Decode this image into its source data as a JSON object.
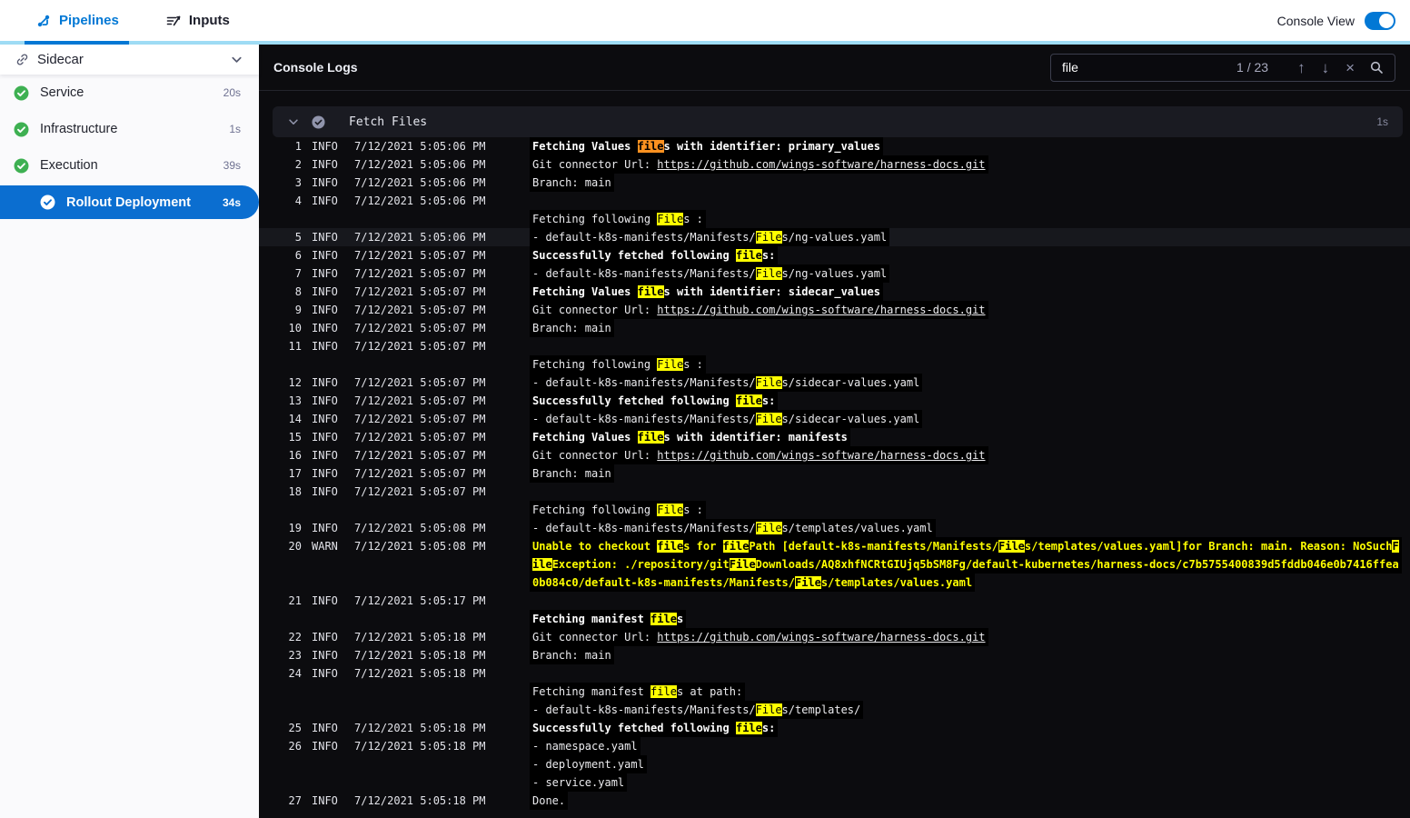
{
  "top_nav": {
    "tabs": [
      {
        "label": "Pipelines"
      },
      {
        "label": "Inputs"
      }
    ],
    "console_view_label": "Console View",
    "toggle_on": true
  },
  "sidebar": {
    "title": "Sidecar",
    "items": [
      {
        "label": "Service",
        "duration": "20s",
        "status": "success"
      },
      {
        "label": "Infrastructure",
        "duration": "1s",
        "status": "success"
      },
      {
        "label": "Execution",
        "duration": "39s",
        "status": "success"
      },
      {
        "label": "Rollout Deployment",
        "duration": "34s",
        "status": "success",
        "selected": true
      }
    ]
  },
  "console": {
    "title": "Console Logs",
    "search": {
      "value": "file",
      "counter": "1 / 23"
    },
    "section": {
      "title": "Fetch Files",
      "duration": "1s"
    }
  },
  "colors": {
    "primary_blue": "#0278d5",
    "selected_pill_blue": "#0b6ed0",
    "success_green": "#3eb052",
    "match_highlight": "#ffff00",
    "current_match_highlight": "#fb9120",
    "warn_text": "#ffff00",
    "tab_underline_light": "#9edcf5"
  },
  "log_rows": [
    {
      "n": "1",
      "lvl": "INFO",
      "t": "7/12/2021 5:05:06 PM",
      "seg": [
        [
          "Fetching Values ",
          "b"
        ],
        [
          "file",
          "ho"
        ],
        [
          "s with identifier: primary_values",
          "b"
        ]
      ]
    },
    {
      "n": "2",
      "lvl": "INFO",
      "t": "7/12/2021 5:05:06 PM",
      "seg": [
        [
          "Git connector Url: ",
          "n"
        ],
        [
          "https://github.com/wings-software/harness-docs.git",
          "l"
        ]
      ]
    },
    {
      "n": "3",
      "lvl": "INFO",
      "t": "7/12/2021 5:05:06 PM",
      "seg": [
        [
          "Branch: main",
          "n"
        ]
      ]
    },
    {
      "n": "4",
      "lvl": "INFO",
      "t": "7/12/2021 5:05:06 PM",
      "seg": []
    },
    {
      "seg": [
        [
          "Fetching following ",
          "n"
        ],
        [
          "File",
          "hy"
        ],
        [
          "s :",
          "n"
        ]
      ]
    },
    {
      "n": "5",
      "lvl": "INFO",
      "t": "7/12/2021 5:05:06 PM",
      "active": true,
      "seg": [
        [
          "- default-k8s-manifests/Manifests/",
          "n"
        ],
        [
          "File",
          "hy"
        ],
        [
          "s/ng-values.yaml",
          "n"
        ]
      ]
    },
    {
      "n": "6",
      "lvl": "INFO",
      "t": "7/12/2021 5:05:07 PM",
      "seg": [
        [
          "Successfully fetched following ",
          "b"
        ],
        [
          "file",
          "hyb"
        ],
        [
          "s:",
          "b"
        ]
      ]
    },
    {
      "n": "7",
      "lvl": "INFO",
      "t": "7/12/2021 5:05:07 PM",
      "seg": [
        [
          "- default-k8s-manifests/Manifests/",
          "n"
        ],
        [
          "File",
          "hy"
        ],
        [
          "s/ng-values.yaml",
          "n"
        ]
      ]
    },
    {
      "n": "8",
      "lvl": "INFO",
      "t": "7/12/2021 5:05:07 PM",
      "seg": [
        [
          "Fetching Values ",
          "b"
        ],
        [
          "file",
          "hyb"
        ],
        [
          "s with identifier: sidecar_values",
          "b"
        ]
      ]
    },
    {
      "n": "9",
      "lvl": "INFO",
      "t": "7/12/2021 5:05:07 PM",
      "seg": [
        [
          "Git connector Url: ",
          "n"
        ],
        [
          "https://github.com/wings-software/harness-docs.git",
          "l"
        ]
      ]
    },
    {
      "n": "10",
      "lvl": "INFO",
      "t": "7/12/2021 5:05:07 PM",
      "seg": [
        [
          "Branch: main",
          "n"
        ]
      ]
    },
    {
      "n": "11",
      "lvl": "INFO",
      "t": "7/12/2021 5:05:07 PM",
      "seg": []
    },
    {
      "seg": [
        [
          "Fetching following ",
          "n"
        ],
        [
          "File",
          "hy"
        ],
        [
          "s :",
          "n"
        ]
      ]
    },
    {
      "n": "12",
      "lvl": "INFO",
      "t": "7/12/2021 5:05:07 PM",
      "seg": [
        [
          "- default-k8s-manifests/Manifests/",
          "n"
        ],
        [
          "File",
          "hy"
        ],
        [
          "s/sidecar-values.yaml",
          "n"
        ]
      ]
    },
    {
      "n": "13",
      "lvl": "INFO",
      "t": "7/12/2021 5:05:07 PM",
      "seg": [
        [
          "Successfully fetched following ",
          "b"
        ],
        [
          "file",
          "hyb"
        ],
        [
          "s:",
          "b"
        ]
      ]
    },
    {
      "n": "14",
      "lvl": "INFO",
      "t": "7/12/2021 5:05:07 PM",
      "seg": [
        [
          "- default-k8s-manifests/Manifests/",
          "n"
        ],
        [
          "File",
          "hy"
        ],
        [
          "s/sidecar-values.yaml",
          "n"
        ]
      ]
    },
    {
      "n": "15",
      "lvl": "INFO",
      "t": "7/12/2021 5:05:07 PM",
      "seg": [
        [
          "Fetching Values ",
          "b"
        ],
        [
          "file",
          "hyb"
        ],
        [
          "s with identifier: manifests",
          "b"
        ]
      ]
    },
    {
      "n": "16",
      "lvl": "INFO",
      "t": "7/12/2021 5:05:07 PM",
      "seg": [
        [
          "Git connector Url: ",
          "n"
        ],
        [
          "https://github.com/wings-software/harness-docs.git",
          "l"
        ]
      ]
    },
    {
      "n": "17",
      "lvl": "INFO",
      "t": "7/12/2021 5:05:07 PM",
      "seg": [
        [
          "Branch: main",
          "n"
        ]
      ]
    },
    {
      "n": "18",
      "lvl": "INFO",
      "t": "7/12/2021 5:05:07 PM",
      "seg": []
    },
    {
      "seg": [
        [
          "Fetching following ",
          "n"
        ],
        [
          "File",
          "hy"
        ],
        [
          "s :",
          "n"
        ]
      ]
    },
    {
      "n": "19",
      "lvl": "INFO",
      "t": "7/12/2021 5:05:08 PM",
      "seg": [
        [
          "- default-k8s-manifests/Manifests/",
          "n"
        ],
        [
          "File",
          "hy"
        ],
        [
          "s/templates/values.yaml",
          "n"
        ]
      ]
    },
    {
      "n": "20",
      "lvl": "WARN",
      "t": "7/12/2021 5:05:08 PM",
      "seg": [
        [
          "Unable to checkout ",
          "w"
        ],
        [
          "file",
          "hyb"
        ],
        [
          "s for ",
          "w"
        ],
        [
          "file",
          "hyb"
        ],
        [
          "Path [default-k8s-manifests/Manifests/",
          "w"
        ],
        [
          "File",
          "hyb"
        ],
        [
          "s/templates/values.yaml]for Branch: main. Reason: NoSuch",
          "w"
        ],
        [
          "F",
          "hyb"
        ]
      ]
    },
    {
      "seg": [
        [
          "ile",
          "hyb"
        ],
        [
          "Exception: ./repository/git",
          "w"
        ],
        [
          "File",
          "hyb"
        ],
        [
          "Downloads/AQ8xhfNCRtGIUjq5bSM8Fg/default-kubernetes/harness-docs/c7b5755400839d5fddb046e0b7416ffea",
          "w"
        ]
      ]
    },
    {
      "seg": [
        [
          "0b084c0/default-k8s-manifests/Manifests/",
          "w"
        ],
        [
          "File",
          "hyb"
        ],
        [
          "s/templates/values.yaml",
          "w"
        ]
      ]
    },
    {
      "n": "21",
      "lvl": "INFO",
      "t": "7/12/2021 5:05:17 PM",
      "seg": []
    },
    {
      "seg": [
        [
          "Fetching manifest ",
          "b"
        ],
        [
          "file",
          "hyb"
        ],
        [
          "s",
          "b"
        ]
      ]
    },
    {
      "n": "22",
      "lvl": "INFO",
      "t": "7/12/2021 5:05:18 PM",
      "seg": [
        [
          "Git connector Url: ",
          "n"
        ],
        [
          "https://github.com/wings-software/harness-docs.git",
          "l"
        ]
      ]
    },
    {
      "n": "23",
      "lvl": "INFO",
      "t": "7/12/2021 5:05:18 PM",
      "seg": [
        [
          "Branch: main",
          "n"
        ]
      ]
    },
    {
      "n": "24",
      "lvl": "INFO",
      "t": "7/12/2021 5:05:18 PM",
      "seg": []
    },
    {
      "seg": [
        [
          "Fetching manifest ",
          "n"
        ],
        [
          "file",
          "hy"
        ],
        [
          "s at path:",
          "n"
        ]
      ]
    },
    {
      "seg": [
        [
          "- default-k8s-manifests/Manifests/",
          "n"
        ],
        [
          "File",
          "hy"
        ],
        [
          "s/templates/",
          "n"
        ]
      ]
    },
    {
      "n": "25",
      "lvl": "INFO",
      "t": "7/12/2021 5:05:18 PM",
      "seg": [
        [
          "Successfully fetched following ",
          "b"
        ],
        [
          "file",
          "hyb"
        ],
        [
          "s:",
          "b"
        ]
      ]
    },
    {
      "n": "26",
      "lvl": "INFO",
      "t": "7/12/2021 5:05:18 PM",
      "seg": [
        [
          "- namespace.yaml",
          "n"
        ]
      ]
    },
    {
      "seg": [
        [
          "- deployment.yaml",
          "n"
        ]
      ]
    },
    {
      "seg": [
        [
          "- service.yaml",
          "n"
        ]
      ]
    },
    {
      "n": "27",
      "lvl": "INFO",
      "t": "7/12/2021 5:05:18 PM",
      "seg": [
        [
          "Done.",
          "n"
        ]
      ]
    }
  ]
}
